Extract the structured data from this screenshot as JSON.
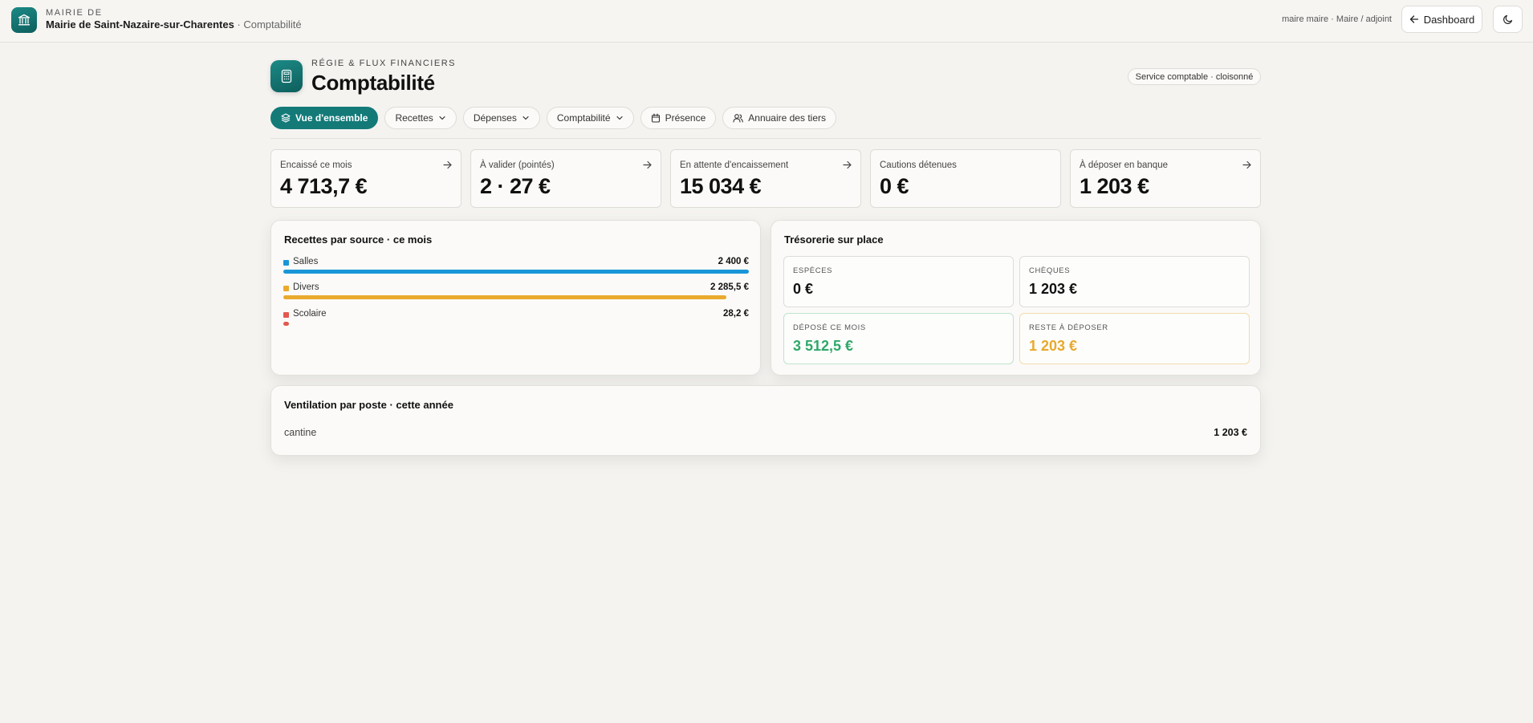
{
  "topbar": {
    "org_small": "MAIRIE DE",
    "org_name": "Mairie de Saint-Nazaire-sur-Charentes",
    "org_section": " · Comptabilité",
    "user": "maire maire · Maire / adjoint",
    "dashboard_label": "Dashboard"
  },
  "header": {
    "eyebrow": "RÉGIE & FLUX FINANCIERS",
    "title": "Comptabilité",
    "badge": "Service comptable · cloisonné"
  },
  "tabs": [
    {
      "label": "Vue d'ensemble",
      "icon": "layers-icon",
      "active": true
    },
    {
      "label": "Recettes",
      "icon": "chevron-down-icon"
    },
    {
      "label": "Dépenses",
      "icon": "chevron-down-icon"
    },
    {
      "label": "Comptabilité",
      "icon": "chevron-down-icon"
    },
    {
      "label": "Présence",
      "icon": "calendar-icon"
    },
    {
      "label": "Annuaire des tiers",
      "icon": "users-icon"
    }
  ],
  "kpis": [
    {
      "label": "Encaissé ce mois",
      "value": "4 713,7 €",
      "arrow": true
    },
    {
      "label": "À valider (pointés)",
      "value": "2 · 27 €",
      "arrow": true
    },
    {
      "label": "En attente d'encaissement",
      "value": "15 034 €",
      "arrow": true
    },
    {
      "label": "Cautions détenues",
      "value": "0 €",
      "arrow": false
    },
    {
      "label": "À déposer en banque",
      "value": "1 203 €",
      "arrow": true
    }
  ],
  "sources": {
    "title": "Recettes par source · ce mois",
    "items": [
      {
        "label": "Salles",
        "value": "2 400 €",
        "share": 1.0,
        "color": "#1a96d8"
      },
      {
        "label": "Divers",
        "value": "2 285,5 €",
        "share": 0.952,
        "color": "#eaaa2e"
      },
      {
        "label": "Scolaire",
        "value": "28,2 €",
        "share": 0.0118,
        "color": "#e25a4f"
      }
    ]
  },
  "tresorerie": {
    "title": "Trésorerie sur place",
    "especes": {
      "label": "ESPÈCES",
      "value": "0 €"
    },
    "cheques": {
      "label": "CHÈQUES",
      "value": "1 203 €"
    },
    "depose": {
      "label": "DÉPOSÉ CE MOIS",
      "value": "3 512,5 €",
      "color": "#2fa86a"
    },
    "reste": {
      "label": "RESTE À DÉPOSER",
      "value": "1 203 €",
      "color": "#e9a92b"
    }
  },
  "ventilation": {
    "title": "Ventilation par poste · cette année",
    "rows": [
      {
        "label": "cantine",
        "value": "1 203 €"
      }
    ]
  },
  "colors": {
    "accent": "#137a78",
    "background": "#f4f3f0"
  }
}
